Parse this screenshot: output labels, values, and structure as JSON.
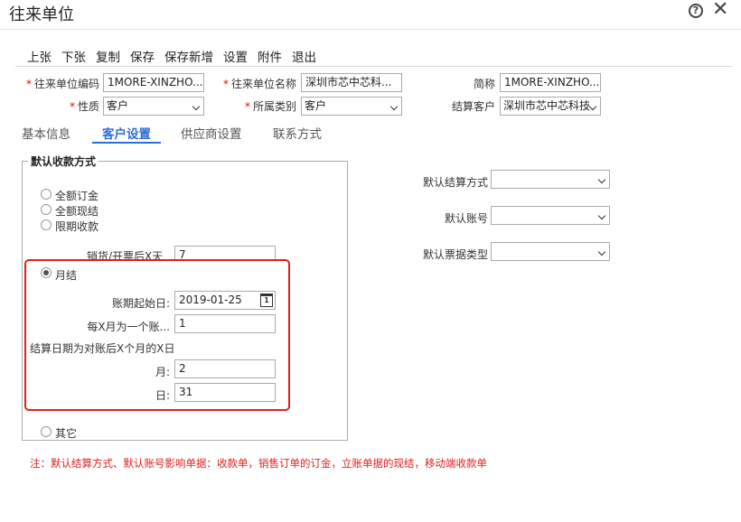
{
  "window": {
    "title": "往来单位"
  },
  "toolbar": {
    "items": [
      "上张",
      "下张",
      "复制",
      "保存",
      "保存新增",
      "设置",
      "附件",
      "退出"
    ]
  },
  "form": {
    "code_label": "往来单位编码",
    "code_value": "1MORE-XINZHO...",
    "name_label": "往来单位名称",
    "name_value": "深圳市芯中芯科...",
    "short_label": "简称",
    "short_value": "1MORE-XINZHO...",
    "nature_label": "性质",
    "nature_value": "客户",
    "category_label": "所属类别",
    "category_value": "客户",
    "settle_customer_label": "结算客户",
    "settle_customer_value": "深圳市芯中芯科技"
  },
  "tabs": [
    "基本信息",
    "客户设置",
    "供应商设置",
    "联系方式"
  ],
  "receipt": {
    "legend": "默认收款方式",
    "options": [
      "全额订金",
      "全额现结",
      "限期收款"
    ],
    "days_label": "销货/开票后X天",
    "days_value": "7",
    "monthly_label": "月结",
    "start_date_label": "账期起始日:",
    "start_date_value": "2019-01-25",
    "calendar_day": "1",
    "every_x_label": "每X月为一个账...",
    "every_x_value": "1",
    "settle_desc": "结算日期为对账后X个月的X日",
    "month_label": "月:",
    "month_value": "2",
    "day_label": "日:",
    "day_value": "31",
    "other_label": "其它"
  },
  "right": {
    "settle_method_label": "默认结算方式",
    "settle_method_value": "",
    "account_label": "默认账号",
    "account_value": "",
    "bill_type_label": "默认票据类型",
    "bill_type_value": ""
  },
  "note": "注：默认结算方式、默认账号影响单据：收款单，销售订单的订金，立账单据的现结，移动端收款单",
  "colors": {
    "accent": "#2d6fd4",
    "highlight": "#e02020"
  }
}
